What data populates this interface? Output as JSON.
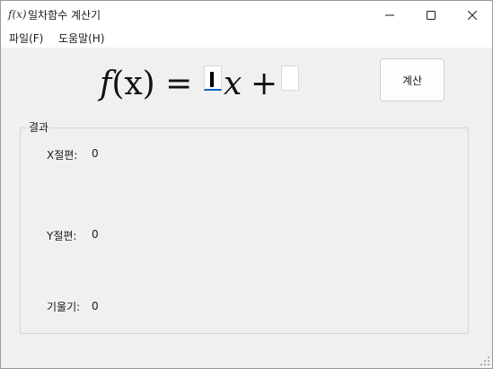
{
  "window": {
    "title": "일차함수 계산기",
    "app_icon_text": "f(x)"
  },
  "menu": {
    "file": "파일(F)",
    "help": "도움말(H)"
  },
  "formula": {
    "lhs_func": "f",
    "lhs_rest": "(x) =",
    "variable": "x",
    "plus": "+",
    "coefficient_a": "",
    "constant_b": ""
  },
  "calculate_button": "계산",
  "result": {
    "group_title": "결과",
    "x_intercept_label": "X절편:",
    "x_intercept_value": "0",
    "y_intercept_label": "Y절편:",
    "y_intercept_value": "0",
    "slope_label": "기울기:",
    "slope_value": "0"
  },
  "colors": {
    "accent": "#0067c0",
    "background": "#f0f0f0",
    "titlebar": "#ffffff"
  }
}
